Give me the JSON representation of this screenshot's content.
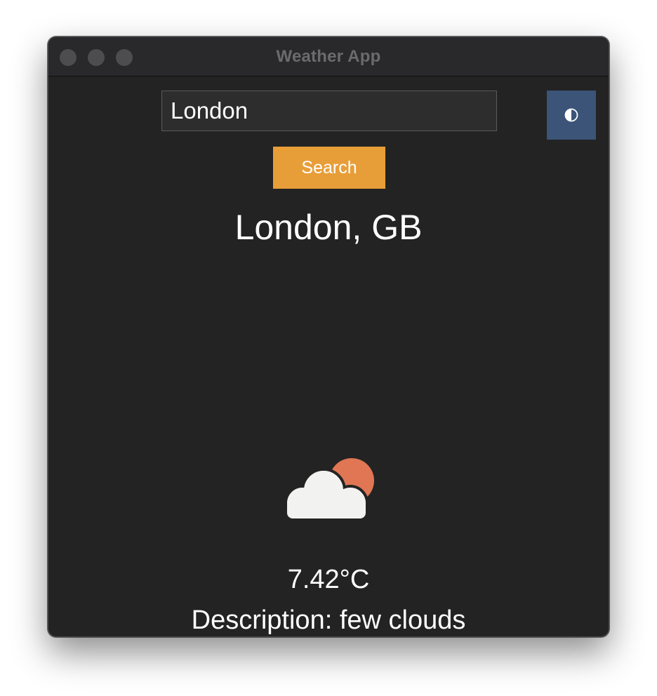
{
  "window": {
    "title": "Weather App"
  },
  "search": {
    "value": "London",
    "button_label": "Search"
  },
  "theme_toggle": {
    "icon": "half-circle-contrast-icon",
    "color": "#3b5478"
  },
  "weather": {
    "location": "London, GB",
    "icon": "few-clouds-icon",
    "temperature": "7.42°C",
    "description": "Description: few clouds"
  },
  "colors": {
    "background": "#232323",
    "accent": "#e89e38",
    "toggle": "#3b5478",
    "sun": "#e07654",
    "cloud": "#f2f2f0"
  }
}
